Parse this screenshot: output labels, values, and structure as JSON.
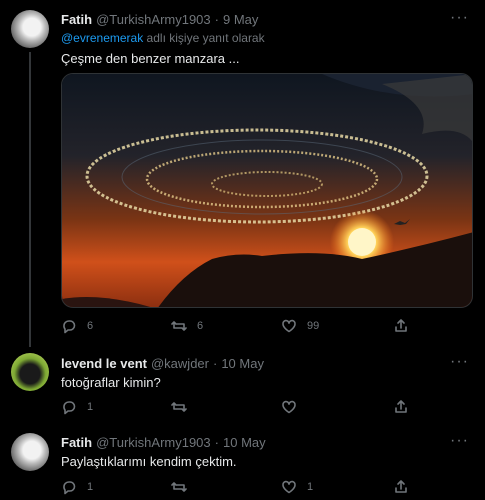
{
  "tweets": [
    {
      "name": "Fatih",
      "handle": "@TurkishArmy1903",
      "date": "9 May",
      "reply_prefix": "@evrenemerak",
      "reply_suffix": " adlı kişiye yanıt olarak",
      "text": "Çeşme den benzer manzara ...",
      "replies": "6",
      "retweets": "6",
      "likes": "99",
      "avatar_icon": "moon-avatar"
    },
    {
      "name": "levend le vent",
      "handle": "@kawjder",
      "date": "10 May",
      "text": "fotoğraflar kimin?",
      "replies": "1",
      "retweets": "",
      "likes": "",
      "avatar_icon": "cat-avatar"
    },
    {
      "name": "Fatih",
      "handle": "@TurkishArmy1903",
      "date": "10 May",
      "text": "Paylaştıklarımı kendim çektim.",
      "replies": "1",
      "retweets": "",
      "likes": "1",
      "avatar_icon": "moon-avatar"
    }
  ],
  "separator": "·",
  "more_glyph": "···",
  "colors": {
    "background": "#000000",
    "link": "#1d9bf0",
    "muted": "#71767b"
  }
}
